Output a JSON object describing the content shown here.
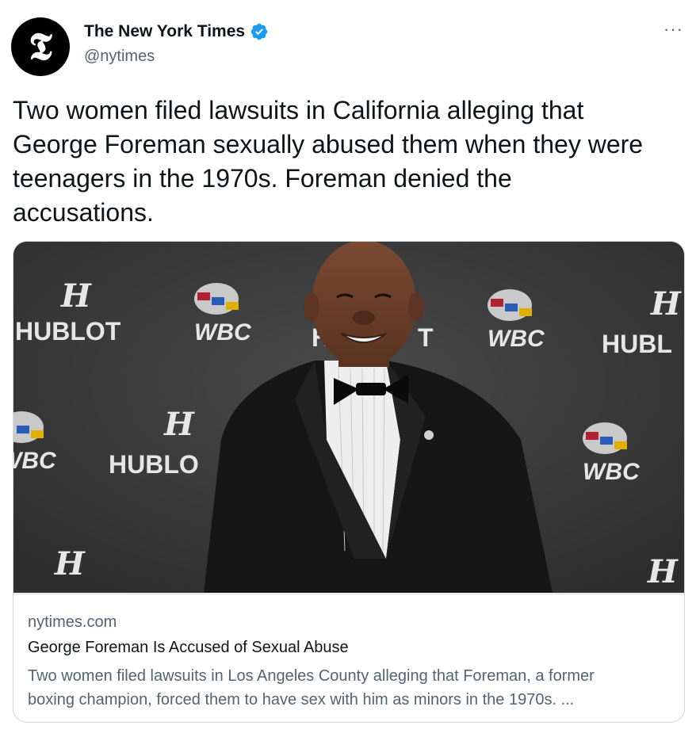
{
  "author": {
    "display_name": "The New York Times",
    "handle": "@nytimes",
    "avatar_glyph": "𝕿",
    "verified": true,
    "verified_color": "#1d9bf0"
  },
  "more_label": "···",
  "tweet_text": "Two women filed lawsuits in California alleging that\nGeorge Foreman sexually abused them when they were\nteenagers in the 1970s. Foreman denied the\naccusations.",
  "card": {
    "image": {
      "backdrop_logos": [
        "HUBLOT",
        "WBC"
      ]
    },
    "domain": "nytimes.com",
    "title": "George Foreman Is Accused of Sexual Abuse",
    "description": "Two women filed lawsuits in Los Angeles County alleging that Foreman, a former\nboxing champion, forced them to have sex with him as minors in the 1970s. ..."
  },
  "colors": {
    "text_primary": "#0f1419",
    "text_secondary": "#536471",
    "border": "#cfd9de",
    "backdrop": "#3b3b3b"
  }
}
